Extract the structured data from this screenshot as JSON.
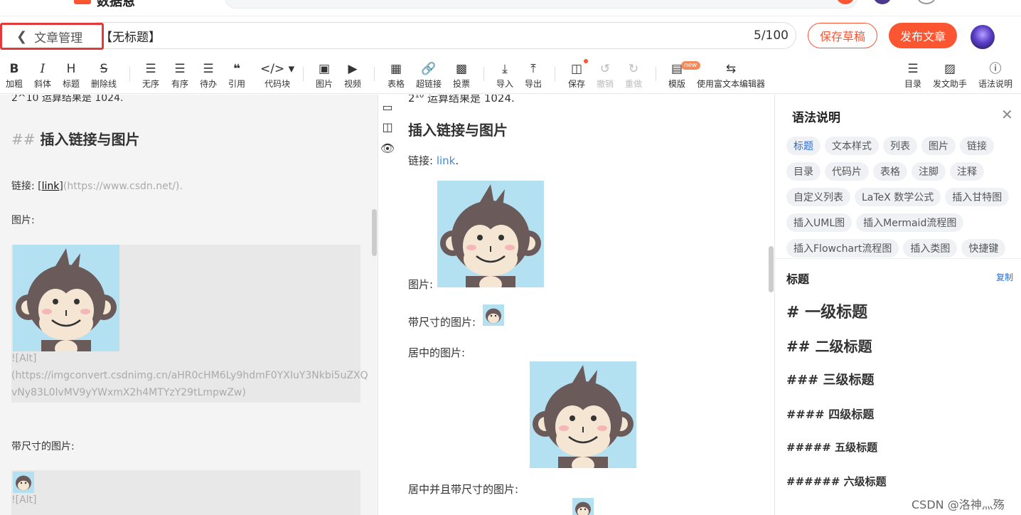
{
  "site": {
    "logo_text": "数据恩"
  },
  "header": {
    "back_label": "文章管理",
    "title_value": "【无标题】",
    "title_count": "5/100",
    "save_draft": "保存草稿",
    "publish": "发布文章"
  },
  "toolbar": {
    "items": [
      {
        "label": "加粗",
        "icon": "bold-icon"
      },
      {
        "label": "斜体",
        "icon": "italic-icon"
      },
      {
        "label": "标题",
        "icon": "heading-icon"
      },
      {
        "label": "删除线",
        "icon": "strikethrough-icon"
      },
      {
        "label": "无序",
        "icon": "unordered-list-icon"
      },
      {
        "label": "有序",
        "icon": "ordered-list-icon"
      },
      {
        "label": "待办",
        "icon": "todo-list-icon"
      },
      {
        "label": "引用",
        "icon": "quote-icon"
      },
      {
        "label": "代码块",
        "icon": "code-icon"
      },
      {
        "label": "图片",
        "icon": "image-icon"
      },
      {
        "label": "视频",
        "icon": "video-icon"
      },
      {
        "label": "表格",
        "icon": "table-icon"
      },
      {
        "label": "超链接",
        "icon": "link-icon"
      },
      {
        "label": "投票",
        "icon": "vote-icon"
      },
      {
        "label": "导入",
        "icon": "import-icon"
      },
      {
        "label": "导出",
        "icon": "export-icon"
      },
      {
        "label": "保存",
        "icon": "save-icon"
      },
      {
        "label": "撤销",
        "icon": "undo-icon"
      },
      {
        "label": "重做",
        "icon": "redo-icon"
      },
      {
        "label": "模版",
        "icon": "template-icon"
      },
      {
        "label": "使用富文本编辑器",
        "icon": "switch-editor-icon"
      },
      {
        "label": "目录",
        "icon": "toc-icon"
      },
      {
        "label": "发文助手",
        "icon": "assistant-icon"
      },
      {
        "label": "语法说明",
        "icon": "help-icon"
      }
    ],
    "new_badge": "new"
  },
  "editor": {
    "top_line": "2^10 运算结果是 1024.",
    "heading_marker": "##",
    "heading_text": "插入链接与图片",
    "link_prefix": "链接: [",
    "link_word": "link",
    "link_suffix_open": "]",
    "link_url": "(https://www.csdn.net/).",
    "image_label": "图片:",
    "alt_line1": "![Alt]",
    "alt_line2": "(https://imgconvert.csdnimg.cn/aHR0cHM6Ly9hdmF0YXIuY3Nkbi5uZXQ",
    "alt_line3": "vNy83L0lvMV9yYWxmX2h4MTYzY29tLmpwZw)",
    "sized_label": "带尺寸的图片:",
    "alt2_line1": "![Alt]"
  },
  "preview": {
    "top_line_base": "2",
    "top_line_sup": "10",
    "top_line_rest": " 运算结果是 1024.",
    "heading": "插入链接与图片",
    "link_prefix": "链接: ",
    "link_word": "link",
    "link_suffix": ".",
    "image_label": "图片:",
    "sized_label": "带尺寸的图片:",
    "centered_label": "居中的图片:",
    "centered_sized_label": "居中并且带尺寸的图片:"
  },
  "help": {
    "title": "语法说明",
    "chips": [
      "标题",
      "文本样式",
      "列表",
      "图片",
      "链接",
      "目录",
      "代码片",
      "表格",
      "注脚",
      "注释",
      "自定义列表",
      "LaTeX 数学公式",
      "插入甘特图",
      "插入UML图",
      "插入Mermaid流程图",
      "插入Flowchart流程图",
      "插入类图",
      "快捷键"
    ],
    "section_title": "标题",
    "copy": "复制",
    "headings": [
      "# 一级标题",
      "## 二级标题",
      "### 三级标题",
      "#### 四级标题",
      "##### 五级标题",
      "###### 六级标题"
    ]
  },
  "watermark": "CSDN @洛神灬殇",
  "colors": {
    "brand": "#fc5531",
    "link": "#3a8ee6",
    "chip_active": "#2c6dd3"
  }
}
